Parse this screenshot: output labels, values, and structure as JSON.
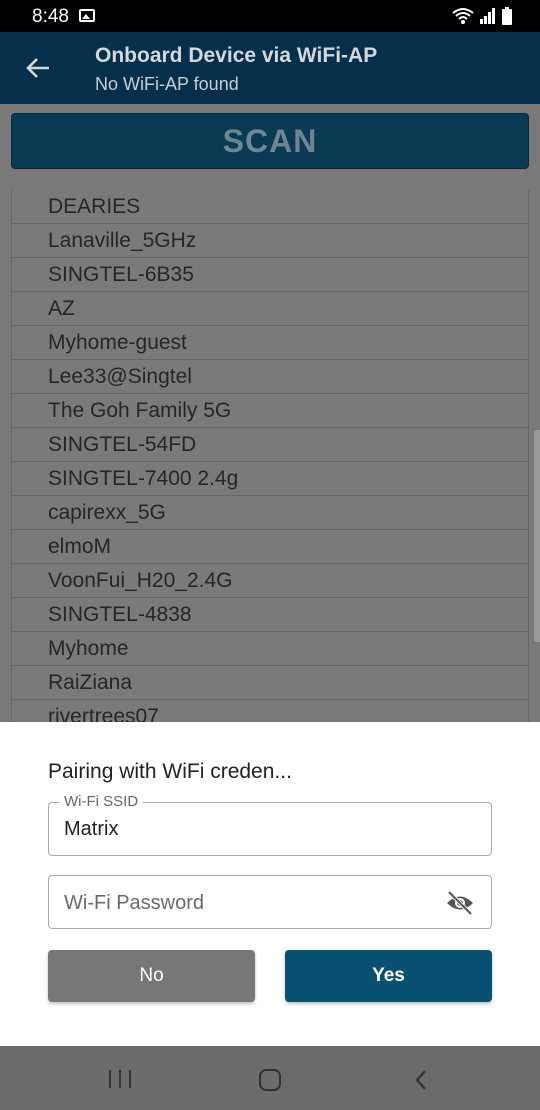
{
  "status_bar": {
    "time": "8:48"
  },
  "app_bar": {
    "title": "Onboard Device via WiFi-AP",
    "subtitle": "No WiFi-AP found"
  },
  "scan_button": {
    "label": "SCAN"
  },
  "networks": [
    "DEARIES",
    "Lanaville_5GHz",
    "SINGTEL-6B35",
    "AZ",
    "Myhome-guest",
    "Lee33@Singtel",
    "The Goh Family 5G",
    "SINGTEL-54FD",
    "SINGTEL-7400 2.4g",
    "capirexx_5G",
    "elmoM",
    "VoonFui_H20_2.4G",
    "SINGTEL-4838",
    "Myhome",
    "RaiZiana",
    "rivertrees07"
  ],
  "dialog": {
    "title": "Pairing with WiFi creden...",
    "ssid_label": "Wi-Fi SSID",
    "ssid_value": "Matrix",
    "password_placeholder": "Wi-Fi Password",
    "no_label": "No",
    "yes_label": "Yes"
  }
}
